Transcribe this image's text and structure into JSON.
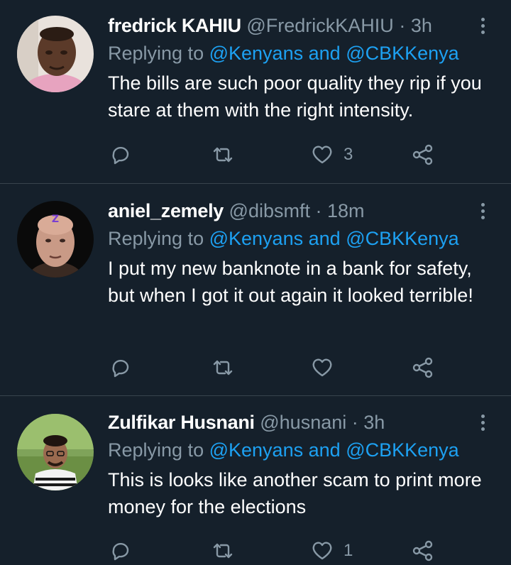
{
  "tweets": [
    {
      "name": "fredrick KAHIU",
      "handle": "@FredrickKAHIU",
      "sep": "·",
      "time": "3h",
      "replying_prefix": "Replying to",
      "mention1": "@Kenyans",
      "and": "and",
      "mention2": "@CBKKenya",
      "text": "The bills are such poor quality they rip if you stare at them with the right intensity.",
      "like_count": "3",
      "retweet_count": ""
    },
    {
      "name": "aniel_zemely",
      "handle": "@dibsmft",
      "sep": "·",
      "time": "18m",
      "replying_prefix": "Replying to",
      "mention1": "@Kenyans",
      "and": "and",
      "mention2": "@CBKKenya",
      "text": "I put my new banknote in a bank for safety, but when I got it out again it looked terrible!",
      "like_count": "",
      "retweet_count": ""
    },
    {
      "name": "Zulfikar Husnani",
      "handle": "@husnani",
      "sep": "·",
      "time": "3h",
      "replying_prefix": "Replying to",
      "mention1": "@Kenyans",
      "and": "and",
      "mention2": "@CBKKenya",
      "text": "This is looks like another scam to print more money for the elections",
      "like_count": "1",
      "retweet_count": ""
    }
  ],
  "icons": {
    "reply": "reply-icon",
    "retweet": "retweet-icon",
    "like": "heart-icon",
    "share": "share-icon",
    "more": "more-vertical-icon"
  },
  "colors": {
    "background": "#15202b",
    "secondary_text": "#8899a6",
    "link": "#1da1f2",
    "divider": "#38444d"
  }
}
